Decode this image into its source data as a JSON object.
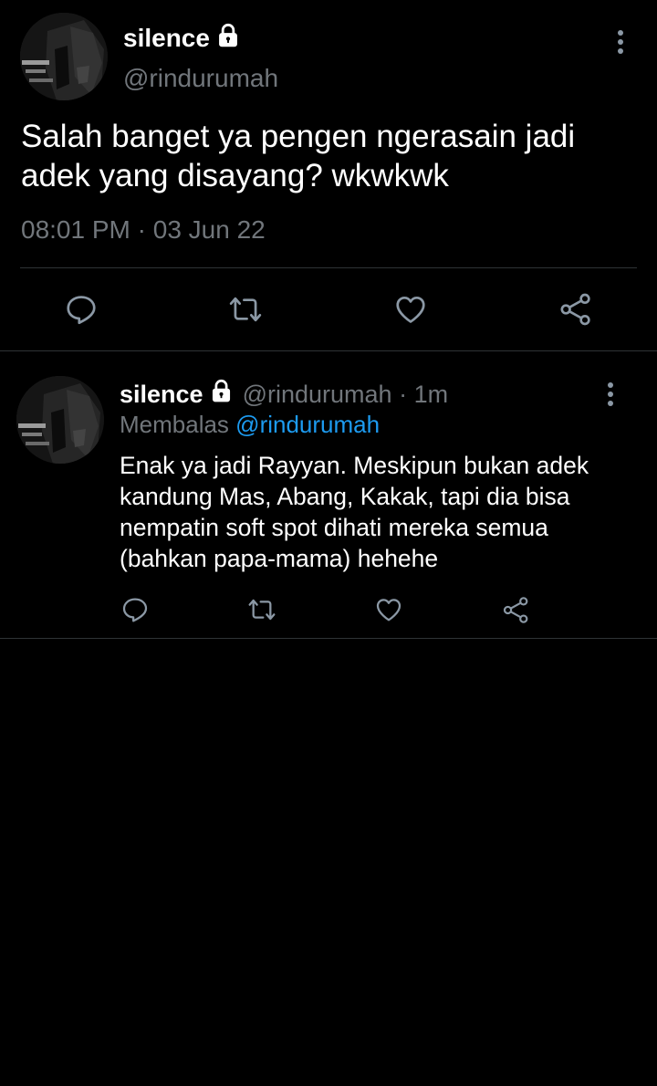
{
  "tweet": {
    "display_name": "silence",
    "handle": "@rindurumah",
    "text": "Salah banget ya pengen ngerasain jadi adek yang disayang? wkwkwk",
    "time": "08:01 PM",
    "separator": "·",
    "date": "03 Jun 22",
    "actions": [
      "reply-icon",
      "retweet-icon",
      "like-icon",
      "share-icon"
    ]
  },
  "reply": {
    "display_name": "silence",
    "handle": "@rindurumah",
    "separator": "·",
    "age": "1m",
    "replying_label": "Membalas",
    "replying_to": "@rindurumah",
    "text": "Enak ya jadi Rayyan. Meskipun bukan adek kandung Mas, Abang, Kakak, tapi dia bisa nempatin soft spot dihati mereka semua (bahkan papa-mama) hehehe",
    "actions": [
      "reply-icon",
      "retweet-icon",
      "like-icon",
      "share-icon"
    ]
  },
  "colors": {
    "background": "#000000",
    "text_primary": "#ffffff",
    "text_secondary": "#71767b",
    "accent_link": "#1d9bf0",
    "icon": "#8b98a5",
    "divider": "#2f3336"
  }
}
